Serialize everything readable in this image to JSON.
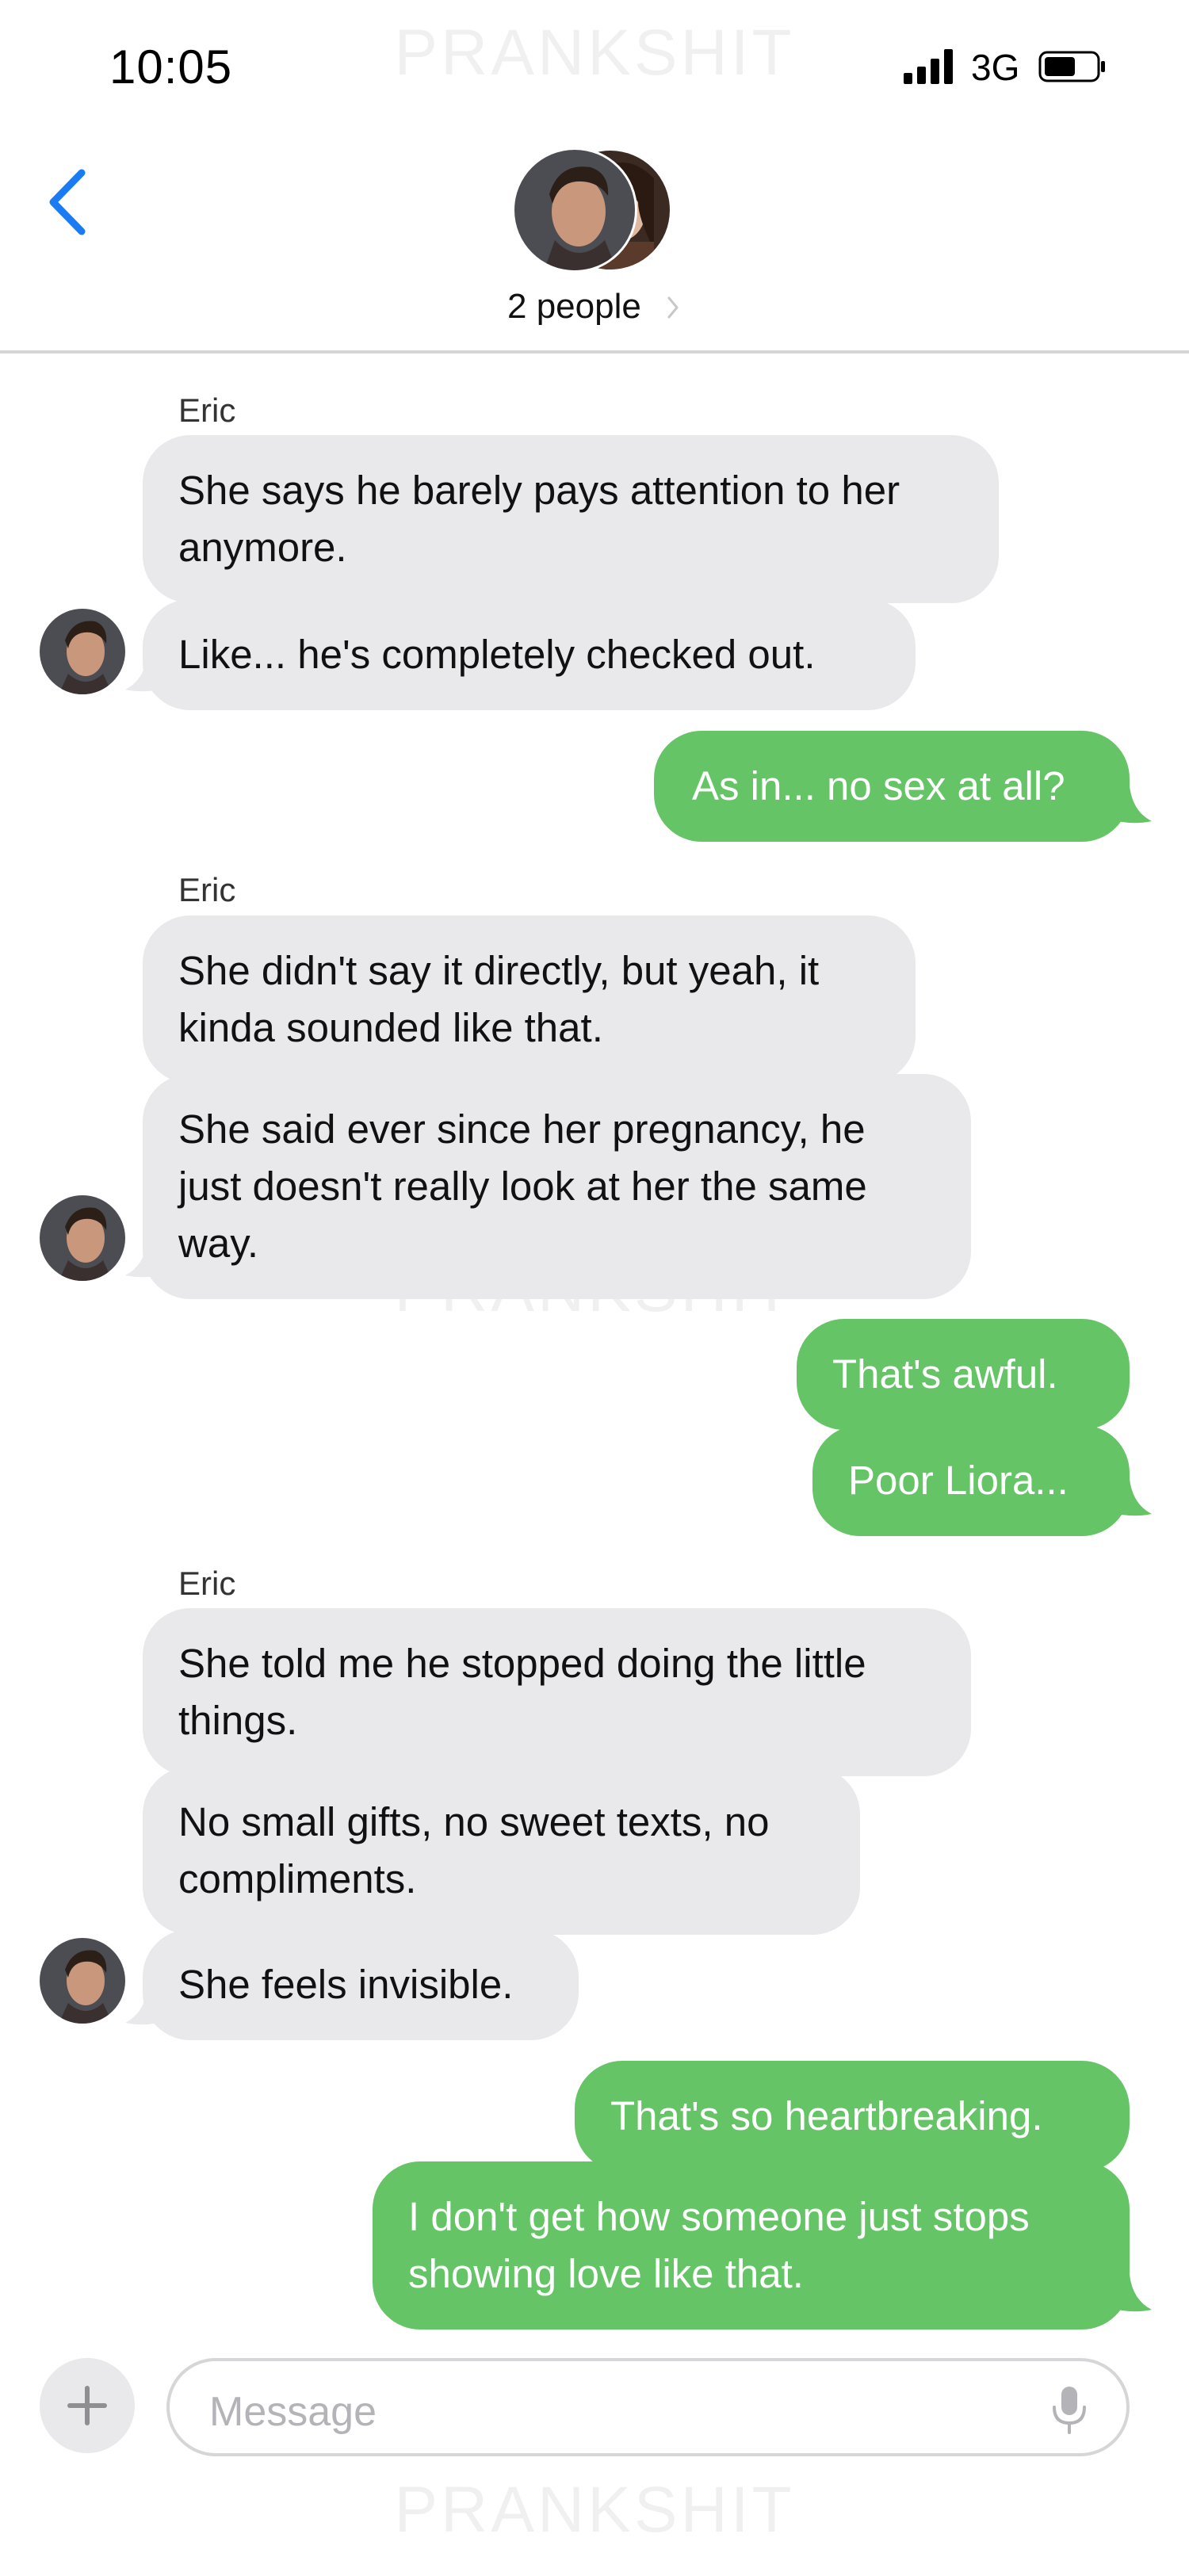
{
  "watermark": "PRANKSHIT",
  "status_bar": {
    "time": "10:05",
    "network": "3G",
    "icons": [
      "signal-icon",
      "battery-icon"
    ]
  },
  "header": {
    "back_icon": "chevron-left-icon",
    "title": "2 people",
    "title_icon": "chevron-right-icon",
    "accent": "#1a7cf5"
  },
  "colors": {
    "incoming_bubble": "#e9e9eb",
    "outgoing_bubble": "#65c466",
    "outgoing_text": "#ffffff"
  },
  "conversation": {
    "group1": {
      "sender": "Eric",
      "m1": "She says he barely pays attention to her anymore.",
      "m2": "Like... he's completely checked out."
    },
    "out1": "As in... no sex at all?",
    "group2": {
      "sender": "Eric",
      "m1": "She didn't say it directly, but yeah, it kinda sounded like that.",
      "m2": "She said ever since her pregnancy, he just doesn't really look at her the same way."
    },
    "out2": "That's awful.",
    "out3": "Poor Liora...",
    "group3": {
      "sender": "Eric",
      "m1": "She told me he stopped doing the little things.",
      "m2": "No small gifts, no sweet texts, no compliments.",
      "m3": "She feels invisible."
    },
    "out4": "That's so heartbreaking.",
    "out5": "I don't get how someone just stops showing love like that."
  },
  "composer": {
    "placeholder": "Message",
    "plus_icon": "plus-icon",
    "mic_icon": "microphone-icon"
  }
}
